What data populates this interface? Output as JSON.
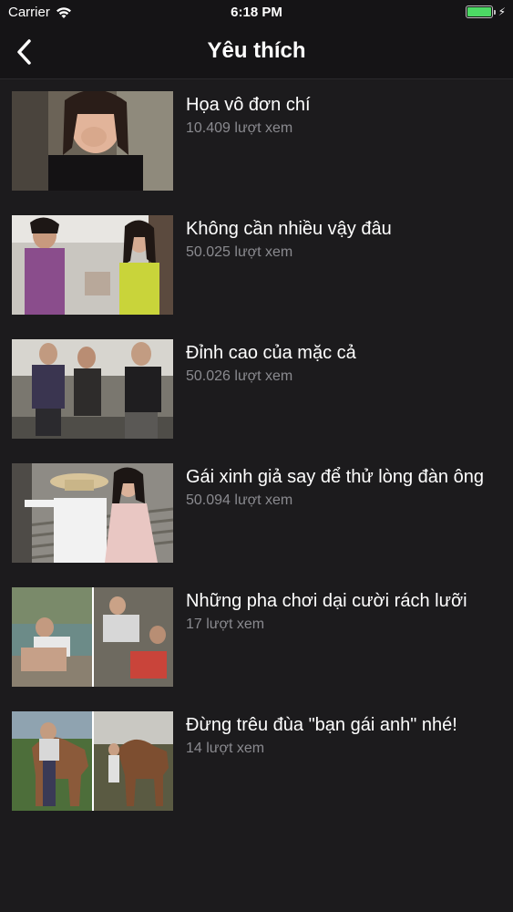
{
  "status_bar": {
    "carrier": "Carrier",
    "time": "6:18 PM",
    "battery_level": 1.0
  },
  "nav": {
    "title": "Yêu thích",
    "back_icon": "chevron-left-icon"
  },
  "videos": [
    {
      "title": "Họa vô đơn chí",
      "views": "10.409 lượt xem"
    },
    {
      "title": "Không cần nhiều vậy đâu",
      "views": "50.025 lượt xem"
    },
    {
      "title": "Đỉnh cao của mặc cả",
      "views": "50.026 lượt xem"
    },
    {
      "title": "Gái xinh giả say để thử lòng đàn ông",
      "views": "50.094 lượt xem"
    },
    {
      "title": "Những pha chơi dại cười rách lưỡi",
      "views": "17 lượt xem"
    },
    {
      "title": "Đừng trêu đùa \"bạn gái anh\" nhé!",
      "views": "14 lượt xem"
    }
  ],
  "colors": {
    "background": "#1c1b1d",
    "bar": "#151416",
    "secondary_text": "#8a8a8f",
    "battery": "#4cd964"
  }
}
